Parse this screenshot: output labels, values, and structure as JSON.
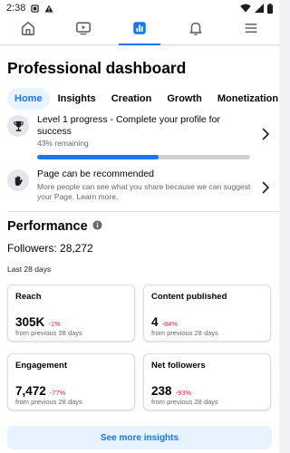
{
  "status_bar": {
    "time": "2:38"
  },
  "tab_bar": {
    "tabs": [
      {
        "icon": "home-icon",
        "active": false
      },
      {
        "icon": "video-icon",
        "active": false
      },
      {
        "icon": "dashboard-icon",
        "active": true
      },
      {
        "icon": "bell-icon",
        "active": false
      },
      {
        "icon": "menu-icon",
        "active": false
      }
    ]
  },
  "page": {
    "title": "Professional dashboard",
    "pills": [
      "Home",
      "Insights",
      "Creation",
      "Growth",
      "Monetization"
    ],
    "active_pill": "Home"
  },
  "level_progress": {
    "icon": "trophy-icon",
    "title": "Level 1 progress - Complete your profile for success",
    "remaining": "43% remaining",
    "progress_fraction": 0.57
  },
  "recommend": {
    "icon": "hand-wave-icon",
    "title": "Page can be recommended",
    "description": "More people can see what you share because we can suggest your Page. Learn more."
  },
  "performance": {
    "title": "Performance",
    "followers": "Followers: 28,272",
    "period": "Last 28 days",
    "cards": [
      {
        "title": "Reach",
        "value": "305K",
        "change": "-1%",
        "note": "from previous 28 days"
      },
      {
        "title": "Content published",
        "value": "4",
        "change": "-84%",
        "note": "from previous 28 days"
      },
      {
        "title": "Engagement",
        "value": "7,472",
        "change": "-77%",
        "note": "from previous 28 days"
      },
      {
        "title": "Net followers",
        "value": "238",
        "change": "-93%",
        "note": "from previous 28 days"
      }
    ],
    "see_more": "See more insights"
  },
  "colors": {
    "accent": "#1877f2",
    "negative": "#e41e3f",
    "pill_bg": "#e7f3ff"
  }
}
